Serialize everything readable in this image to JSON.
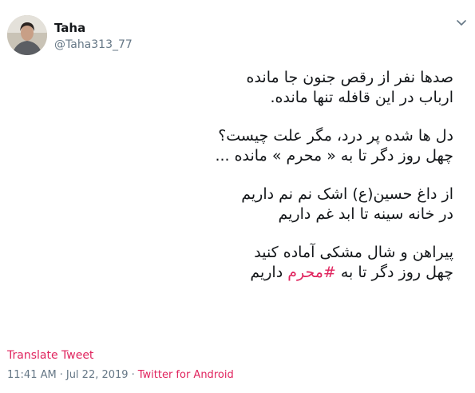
{
  "author": {
    "name": "Taha",
    "handle": "@Taha313_77"
  },
  "tweet": {
    "stanzas": [
      [
        "صدها نفر از رقص جنون جا مانده",
        "ارباب در این قافله تنها مانده."
      ],
      [
        "دل ها شده پر درد، مگر علت چیست؟",
        "چهل روز دگر تا به « محرم » مانده ..."
      ],
      [
        "از داغ حسین(ع) اشک نم نم داریم",
        "در خانه سینه تا ابد غم داریم"
      ],
      [
        "پیراهن و شال مشکی آماده کنید"
      ]
    ],
    "last_line": {
      "prefix": "چهل روز دگر تا به",
      "hashtag": "#محرم",
      "suffix": "داریم"
    }
  },
  "translate_label": "Translate Tweet",
  "meta": {
    "time": "11:41 AM",
    "separator": "·",
    "date": "Jul 22, 2019",
    "source": "Twitter for Android"
  },
  "colors": {
    "accent": "#e0245e",
    "secondary_text": "#657786",
    "primary_text": "#14171a"
  },
  "icons": {
    "menu": "chevron-down-icon"
  }
}
